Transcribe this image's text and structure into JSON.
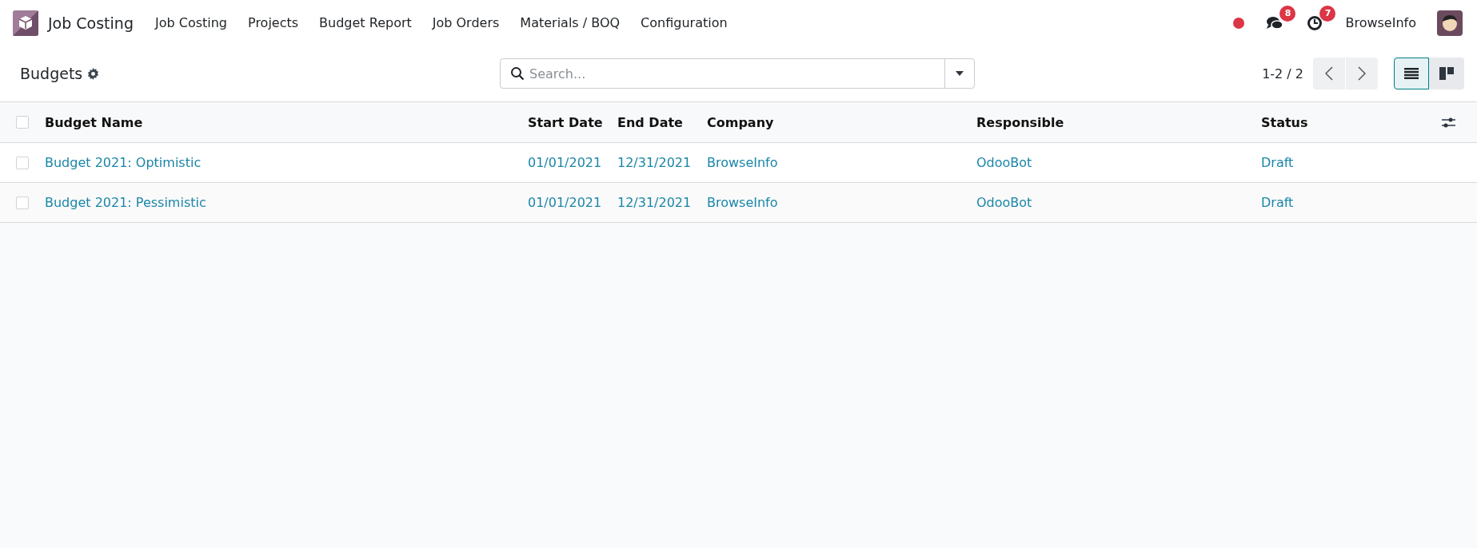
{
  "navbar": {
    "app_name": "Job Costing",
    "menu": [
      "Job Costing",
      "Projects",
      "Budget Report",
      "Job Orders",
      "Materials / BOQ",
      "Configuration"
    ],
    "messages_count": "8",
    "activities_count": "7",
    "user": "BrowseInfo"
  },
  "control_panel": {
    "title": "Budgets",
    "search": {
      "placeholder": "Search..."
    },
    "pager": "1-2 / 2",
    "views": [
      {
        "kind": "list",
        "selected": true
      },
      {
        "kind": "kanban",
        "selected": false
      }
    ]
  },
  "table": {
    "columns": [
      "Budget Name",
      "Start Date",
      "End Date",
      "Company",
      "Responsible",
      "Status"
    ],
    "select_all_checked": false,
    "rows": [
      {
        "checked": false,
        "cells": [
          "Budget 2021: Optimistic",
          "01/01/2021",
          "12/31/2021",
          "BrowseInfo",
          "OdooBot",
          "Draft"
        ]
      },
      {
        "checked": false,
        "cells": [
          "Budget 2021: Pessimistic",
          "01/01/2021",
          "12/31/2021",
          "BrowseInfo",
          "OdooBot",
          "Draft"
        ]
      }
    ]
  }
}
